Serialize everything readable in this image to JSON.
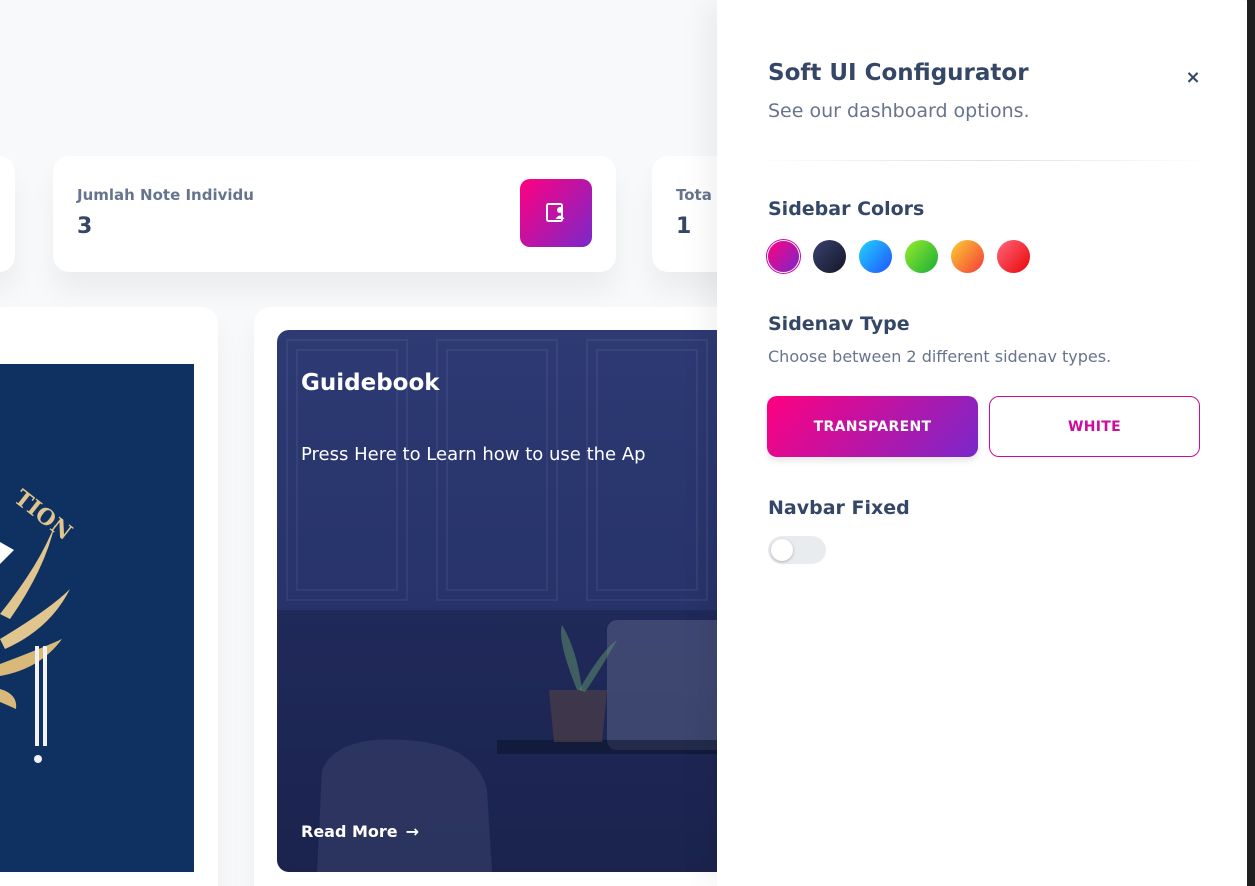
{
  "stat_cards": [
    {
      "label": "Jumlah Note Individu",
      "value": "3"
    },
    {
      "label": "Tota",
      "value": "1"
    }
  ],
  "logo_text": "TION",
  "guide_card": {
    "title": "Guidebook",
    "description": "Press Here to Learn how to use the Ap",
    "link_label": "Read More",
    "link_arrow": "→"
  },
  "configurator": {
    "title": "Soft UI Configurator",
    "subtitle": "See our dashboard options.",
    "close_glyph": "×",
    "sidebar_colors_title": "Sidebar Colors",
    "colors": [
      "#cb0c9f",
      "#252f40",
      "#17c1e8",
      "#82d616",
      "#fbcf33",
      "#ea0606"
    ],
    "sidenav_type_title": "Sidenav Type",
    "sidenav_type_note": "Choose between 2 different sidenav types.",
    "sidenav_buttons": [
      "TRANSPARENT",
      "WHITE"
    ],
    "navbar_fixed_title": "Navbar Fixed",
    "navbar_fixed_on": false
  }
}
